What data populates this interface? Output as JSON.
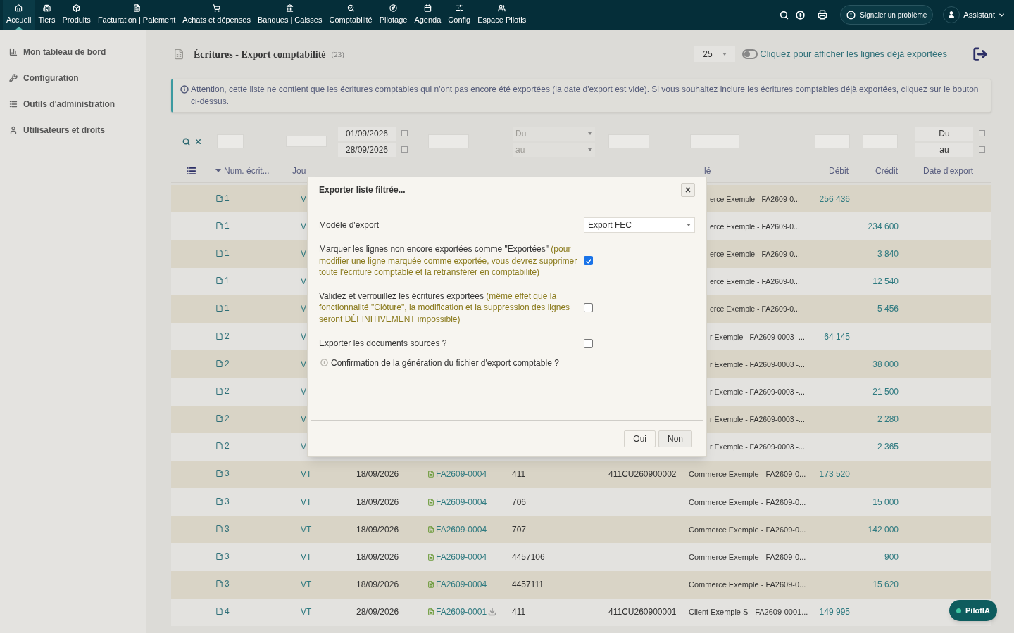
{
  "nav": {
    "items": [
      {
        "label": "Accueil",
        "selected": true
      },
      {
        "label": "Tiers",
        "selected": false
      },
      {
        "label": "Produits",
        "selected": false
      },
      {
        "label": "Facturation | Paiement",
        "selected": false
      },
      {
        "label": "Achats et dépenses",
        "selected": false
      },
      {
        "label": "Banques | Caisses",
        "selected": false
      },
      {
        "label": "Comptabilité",
        "selected": false
      },
      {
        "label": "Pilotage",
        "selected": false
      },
      {
        "label": "Agenda",
        "selected": false
      },
      {
        "label": "Config",
        "selected": false
      },
      {
        "label": "Espace Pilotis",
        "selected": false
      }
    ],
    "report_button": "Signaler un problème",
    "user": "Assistant"
  },
  "sidebar": {
    "items": [
      {
        "label": "Mon tableau de bord"
      },
      {
        "label": "Configuration"
      },
      {
        "label": "Outils d'administration"
      },
      {
        "label": "Utilisateurs et droits"
      }
    ]
  },
  "page": {
    "title": "Écritures - Export comptabilité",
    "count": "(23)",
    "page_size": "25",
    "toggle": {
      "on": false,
      "label": "Cliquez pour afficher les lignes déjà exportées"
    },
    "alert": "Attention, cette liste ne contient que les écritures comptables qui n'ont pas encore été exportées (la date d'export est vide). Si vous souhaitez inclure les écritures comptables déjà exportées, cliquez sur le bouton ci-dessus."
  },
  "filters": {
    "date_from": "01/09/2026",
    "date_to": "28/09/2026",
    "select_from": "Du",
    "select_to": "au",
    "export_from": "Du",
    "export_to": "au"
  },
  "columns": [
    {
      "label": "Num. écrit...",
      "sorted": true
    },
    {
      "label": "Jou",
      "sorted": false
    },
    {
      "label": "lé",
      "sorted": false
    },
    {
      "label": "Débit",
      "sorted": false
    },
    {
      "label": "Crédit",
      "sorted": false
    },
    {
      "label": "Date d'export",
      "sorted": false
    }
  ],
  "rows": [
    {
      "num": "1",
      "journal": "V",
      "label": "erce Exemple - FA2609-0...",
      "debit": "256 436"
    },
    {
      "num": "1",
      "journal": "V",
      "label": "erce Exemple - FA2609-0...",
      "credit": "234 600"
    },
    {
      "num": "1",
      "journal": "V",
      "label": "erce Exemple - FA2609-0...",
      "credit": "3 840"
    },
    {
      "num": "1",
      "journal": "V",
      "label": "erce Exemple - FA2609-0...",
      "credit": "12 540"
    },
    {
      "num": "1",
      "journal": "V",
      "label": "erce Exemple - FA2609-0...",
      "credit": "5 456"
    },
    {
      "num": "2",
      "journal": "V",
      "label": "r Exemple - FA2609-0003 -...",
      "debit": "64 145"
    },
    {
      "num": "2",
      "journal": "V",
      "label": "r Exemple - FA2609-0003 -...",
      "credit": "38 000"
    },
    {
      "num": "2",
      "journal": "V",
      "label": "r Exemple - FA2609-0003 -...",
      "credit": "21 500"
    },
    {
      "num": "2",
      "journal": "V",
      "label": "r Exemple - FA2609-0003 -...",
      "credit": "2 280"
    },
    {
      "num": "2",
      "journal": "V",
      "label": "r Exemple - FA2609-0003 -...",
      "credit": "2 365"
    },
    {
      "num": "3",
      "journal": "VT",
      "date": "18/09/2026",
      "doc": "FA2609-0004",
      "account": "411",
      "subaccount": "411CU260900002",
      "label": "Commerce Exemple - FA2609-0...",
      "debit": "173 520"
    },
    {
      "num": "3",
      "journal": "VT",
      "date": "18/09/2026",
      "doc": "FA2609-0004",
      "account": "706",
      "label": "Commerce Exemple - FA2609-0...",
      "credit": "15 000"
    },
    {
      "num": "3",
      "journal": "VT",
      "date": "18/09/2026",
      "doc": "FA2609-0004",
      "account": "707",
      "label": "Commerce Exemple - FA2609-0...",
      "credit": "142 000"
    },
    {
      "num": "3",
      "journal": "VT",
      "date": "18/09/2026",
      "doc": "FA2609-0004",
      "account": "4457106",
      "label": "Commerce Exemple - FA2609-0...",
      "credit": "900"
    },
    {
      "num": "3",
      "journal": "VT",
      "date": "18/09/2026",
      "doc": "FA2609-0004",
      "account": "4457111",
      "label": "Commerce Exemple - FA2609-0...",
      "credit": "15 620"
    },
    {
      "num": "4",
      "journal": "VT",
      "date": "28/09/2026",
      "doc": "FA2609-0001",
      "download": true,
      "account": "411",
      "subaccount": "411CU260900001",
      "label": "Client Exemple S - FA2609-0001...",
      "debit": "149 995"
    }
  ],
  "modal": {
    "title": "Exporter liste filtrée...",
    "model_label": "Modèle d'export",
    "model_value": "Export FEC",
    "options": [
      {
        "label": "Marquer les lignes non encore exportées comme \"Exportées\"",
        "note": "(pour modifier une ligne marquée comme exportée, vous devrez supprimer toute l'écriture comptable et la retransférer en comptabilité)",
        "checked": true
      },
      {
        "label": "Validez et verrouillez les écritures exportées",
        "note": "(même effet que la fonctionnalité \"Clôture\", la modification et la suppression des lignes seront DÉFINITIVEMENT impossible)",
        "checked": false
      },
      {
        "label": "Exporter les documents sources ?",
        "checked": false
      }
    ],
    "confirmation": "Confirmation de la génération du fichier d'export comptable ?",
    "buttons": [
      "Oui",
      "Non"
    ]
  },
  "assistant_button": "PilotIA"
}
